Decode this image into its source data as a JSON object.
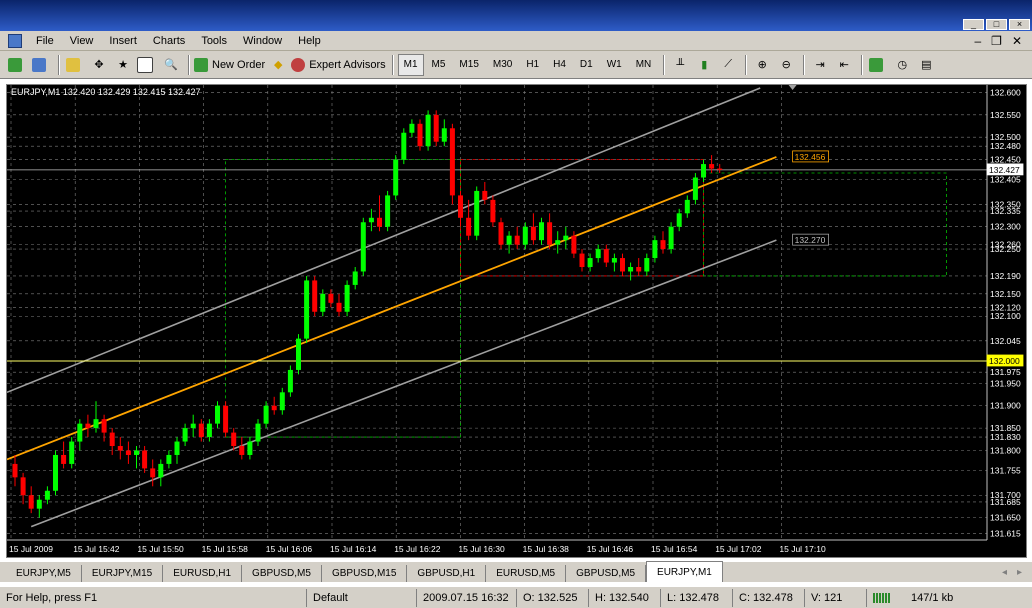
{
  "menu": [
    "File",
    "View",
    "Insert",
    "Charts",
    "Tools",
    "Window",
    "Help"
  ],
  "toolbar": {
    "new_order": "New Order",
    "expert_advisors": "Expert Advisors",
    "timeframes": [
      "M1",
      "M5",
      "M15",
      "M30",
      "H1",
      "H4",
      "D1",
      "W1",
      "MN"
    ],
    "active_timeframe": "M1"
  },
  "chart_header": "EURJPY,M1  132.420 132.429 132.415 132.427",
  "price_labels": {
    "channel_top": "132.456",
    "channel_bottom": "132.270",
    "current": "132.427",
    "level": "132.000"
  },
  "chart_data": {
    "type": "candlestick",
    "symbol": "EURJPY",
    "timeframe": "M1",
    "ylim": [
      131.6,
      132.61
    ],
    "y_ticks": [
      132.6,
      132.55,
      132.5,
      132.48,
      132.45,
      132.405,
      132.35,
      132.335,
      132.3,
      132.26,
      132.25,
      132.19,
      132.15,
      132.12,
      132.1,
      132.045,
      131.975,
      131.95,
      131.9,
      131.85,
      131.83,
      131.8,
      131.755,
      131.7,
      131.685,
      131.65,
      131.615
    ],
    "x_ticks": [
      "15 Jul 2009",
      "15 Jul 15:42",
      "15 Jul 15:50",
      "15 Jul 15:58",
      "15 Jul 16:06",
      "15 Jul 16:14",
      "15 Jul 16:22",
      "15 Jul 16:30",
      "15 Jul 16:38",
      "15 Jul 16:46",
      "15 Jul 16:54",
      "15 Jul 17:02",
      "15 Jul 17:10"
    ],
    "horizontal_levels": [
      132.427,
      132.0
    ],
    "candles_ohlc": [
      [
        131.77,
        131.79,
        131.72,
        131.74
      ],
      [
        131.74,
        131.75,
        131.68,
        131.7
      ],
      [
        131.7,
        131.72,
        131.66,
        131.67
      ],
      [
        131.67,
        131.7,
        131.65,
        131.69
      ],
      [
        131.69,
        131.72,
        131.68,
        131.71
      ],
      [
        131.71,
        131.8,
        131.7,
        131.79
      ],
      [
        131.79,
        131.82,
        131.76,
        131.77
      ],
      [
        131.77,
        131.83,
        131.76,
        131.82
      ],
      [
        131.82,
        131.87,
        131.8,
        131.86
      ],
      [
        131.86,
        131.88,
        131.83,
        131.85
      ],
      [
        131.85,
        131.91,
        131.84,
        131.87
      ],
      [
        131.87,
        131.88,
        131.82,
        131.84
      ],
      [
        131.84,
        131.85,
        131.79,
        131.81
      ],
      [
        131.81,
        131.83,
        131.78,
        131.8
      ],
      [
        131.8,
        131.82,
        131.77,
        131.79
      ],
      [
        131.79,
        131.81,
        131.76,
        131.8
      ],
      [
        131.8,
        131.81,
        131.75,
        131.76
      ],
      [
        131.76,
        131.78,
        131.72,
        131.74
      ],
      [
        131.74,
        131.78,
        131.72,
        131.77
      ],
      [
        131.77,
        131.8,
        131.76,
        131.79
      ],
      [
        131.79,
        131.83,
        131.77,
        131.82
      ],
      [
        131.82,
        131.86,
        131.81,
        131.85
      ],
      [
        131.85,
        131.88,
        131.83,
        131.86
      ],
      [
        131.86,
        131.87,
        131.82,
        131.83
      ],
      [
        131.83,
        131.87,
        131.82,
        131.86
      ],
      [
        131.86,
        131.91,
        131.85,
        131.9
      ],
      [
        131.9,
        131.91,
        131.83,
        131.84
      ],
      [
        131.84,
        131.85,
        131.8,
        131.81
      ],
      [
        131.81,
        131.83,
        131.78,
        131.79
      ],
      [
        131.79,
        131.83,
        131.78,
        131.82
      ],
      [
        131.82,
        131.87,
        131.81,
        131.86
      ],
      [
        131.86,
        131.91,
        131.85,
        131.9
      ],
      [
        131.9,
        131.92,
        131.88,
        131.89
      ],
      [
        131.89,
        131.94,
        131.88,
        131.93
      ],
      [
        131.93,
        131.99,
        131.92,
        131.98
      ],
      [
        131.98,
        132.06,
        131.97,
        132.05
      ],
      [
        132.05,
        132.19,
        132.04,
        132.18
      ],
      [
        132.18,
        132.19,
        132.1,
        132.11
      ],
      [
        132.11,
        132.16,
        132.1,
        132.15
      ],
      [
        132.15,
        132.16,
        132.12,
        132.13
      ],
      [
        132.13,
        132.15,
        132.1,
        132.11
      ],
      [
        132.11,
        132.18,
        132.1,
        132.17
      ],
      [
        132.17,
        132.21,
        132.16,
        132.2
      ],
      [
        132.2,
        132.32,
        132.19,
        132.31
      ],
      [
        132.31,
        132.34,
        132.29,
        132.32
      ],
      [
        132.32,
        132.37,
        132.29,
        132.3
      ],
      [
        132.3,
        132.38,
        132.29,
        132.37
      ],
      [
        132.37,
        132.46,
        132.36,
        132.45
      ],
      [
        132.45,
        132.52,
        132.44,
        132.51
      ],
      [
        132.51,
        132.54,
        132.5,
        132.53
      ],
      [
        132.53,
        132.54,
        132.47,
        132.48
      ],
      [
        132.48,
        132.56,
        132.47,
        132.55
      ],
      [
        132.55,
        132.56,
        132.48,
        132.49
      ],
      [
        132.49,
        132.54,
        132.48,
        132.52
      ],
      [
        132.52,
        132.53,
        132.35,
        132.37
      ],
      [
        132.37,
        132.38,
        132.3,
        132.32
      ],
      [
        132.32,
        132.36,
        132.27,
        132.28
      ],
      [
        132.28,
        132.39,
        132.27,
        132.38
      ],
      [
        132.38,
        132.4,
        132.35,
        132.36
      ],
      [
        132.36,
        132.37,
        132.3,
        132.31
      ],
      [
        132.31,
        132.32,
        132.25,
        132.26
      ],
      [
        132.26,
        132.29,
        132.24,
        132.28
      ],
      [
        132.28,
        132.3,
        132.25,
        132.26
      ],
      [
        132.26,
        132.31,
        132.25,
        132.3
      ],
      [
        132.3,
        132.33,
        132.26,
        132.27
      ],
      [
        132.27,
        132.32,
        132.26,
        132.31
      ],
      [
        132.31,
        132.33,
        132.25,
        132.26
      ],
      [
        132.26,
        132.29,
        132.24,
        132.27
      ],
      [
        132.27,
        132.3,
        132.25,
        132.28
      ],
      [
        132.28,
        132.29,
        132.23,
        132.24
      ],
      [
        132.24,
        132.25,
        132.2,
        132.21
      ],
      [
        132.21,
        132.24,
        132.2,
        132.23
      ],
      [
        132.23,
        132.26,
        132.22,
        132.25
      ],
      [
        132.25,
        132.26,
        132.21,
        132.22
      ],
      [
        132.22,
        132.24,
        132.2,
        132.23
      ],
      [
        132.23,
        132.24,
        132.19,
        132.2
      ],
      [
        132.2,
        132.22,
        132.18,
        132.21
      ],
      [
        132.21,
        132.23,
        132.19,
        132.2
      ],
      [
        132.2,
        132.24,
        132.19,
        132.23
      ],
      [
        132.23,
        132.28,
        132.22,
        132.27
      ],
      [
        132.27,
        132.29,
        132.24,
        132.25
      ],
      [
        132.25,
        132.31,
        132.24,
        132.3
      ],
      [
        132.3,
        132.34,
        132.29,
        132.33
      ],
      [
        132.33,
        132.37,
        132.32,
        132.36
      ],
      [
        132.36,
        132.42,
        132.35,
        132.41
      ],
      [
        132.41,
        132.45,
        132.4,
        132.44
      ],
      [
        132.44,
        132.46,
        132.42,
        132.43
      ],
      [
        132.43,
        132.44,
        132.42,
        132.427
      ]
    ]
  },
  "tabs": [
    "EURJPY,M5",
    "EURJPY,M15",
    "EURUSD,H1",
    "GBPUSD,M5",
    "GBPUSD,M15",
    "GBPUSD,H1",
    "EURUSD,M5",
    "GBPUSD,M5",
    "EURJPY,M1"
  ],
  "active_tab": "EURJPY,M1",
  "status": {
    "help": "For Help, press F1",
    "profile": "Default",
    "datetime": "2009.07.15 16:32",
    "open": "O: 132.525",
    "high": "H: 132.540",
    "low": "L: 132.478",
    "close": "C: 132.478",
    "volume": "V: 121",
    "traffic": "147/1 kb"
  },
  "colors": {
    "bull": "#00ff00",
    "bear": "#ff0000",
    "grid": "#808080",
    "regression": "#ffa500",
    "channel": "#a0a0a0",
    "fibo": "#00c000"
  }
}
